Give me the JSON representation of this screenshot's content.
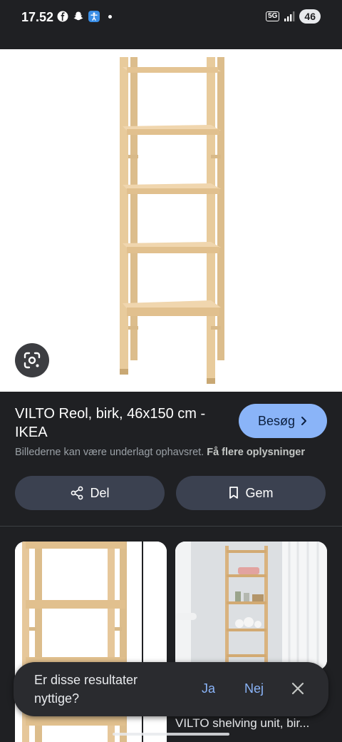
{
  "status_bar": {
    "time": "17.52",
    "network": "5G",
    "battery": "46",
    "icons": [
      "facebook-icon",
      "snapchat-icon",
      "accessibility-icon",
      "dot-icon",
      "signal-icon"
    ]
  },
  "result": {
    "title": "VILTO Reol, birk, 46x150 cm - IKEA",
    "visit_label": "Besøg",
    "notice_text": "Billederne kan være underlagt ophavsret.",
    "notice_link": "Få flere oplysninger",
    "share_label": "Del",
    "save_label": "Gem"
  },
  "related": {
    "cards": [
      {
        "caption": ""
      },
      {
        "caption": "VILTO shelving unit, bir..."
      }
    ]
  },
  "feedback": {
    "question": "Er disse resultater nyttige?",
    "yes": "Ja",
    "no": "Nej"
  },
  "colors": {
    "background": "#1f2023",
    "accent": "#8ab4f8",
    "pill": "#3b4150",
    "wood": "#e6c79a"
  }
}
